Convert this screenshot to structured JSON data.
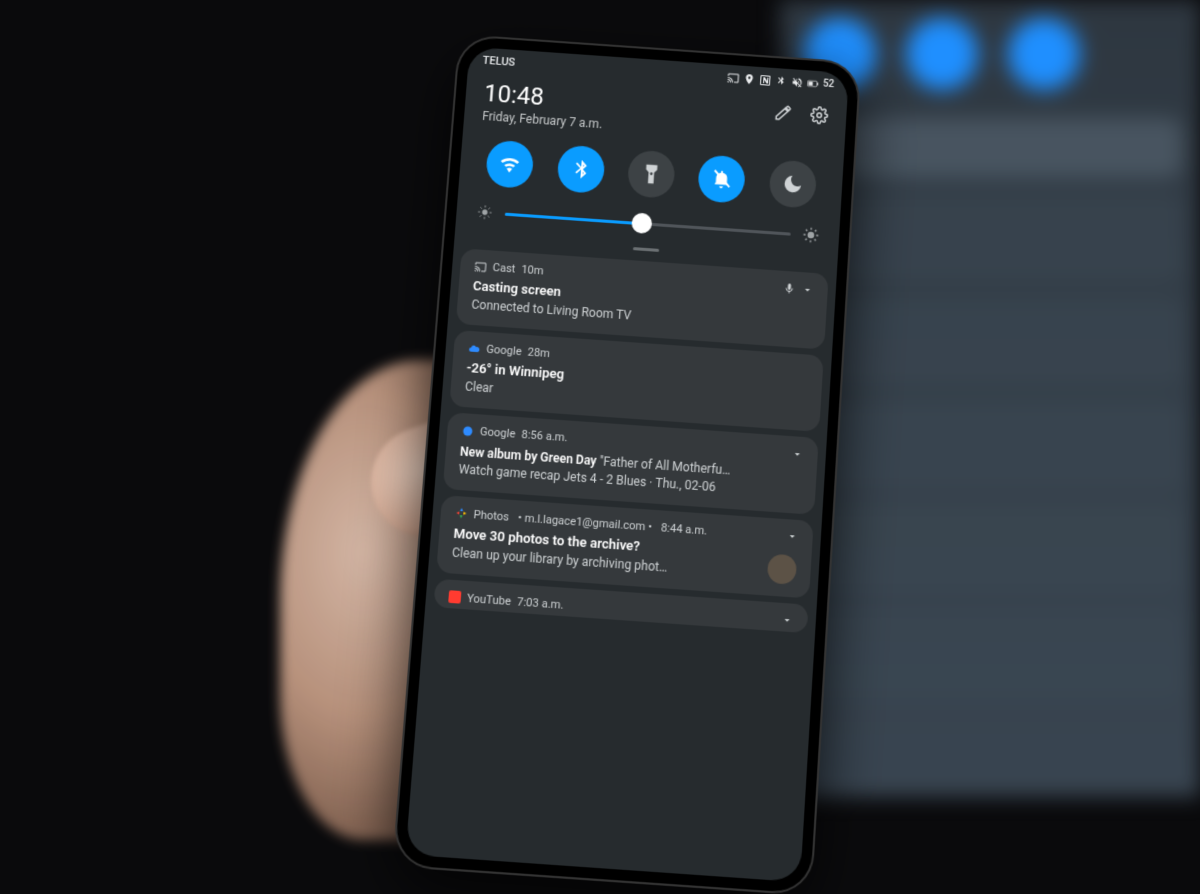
{
  "status": {
    "carrier": "TELUS",
    "battery_text": "52"
  },
  "header": {
    "time": "10:48",
    "date": "Friday, February 7  a.m."
  },
  "toggles": {
    "wifi": true,
    "bluetooth": true,
    "flashlight": false,
    "dnd_bell": true,
    "night": false
  },
  "brightness": {
    "percent": 48
  },
  "notifications": [
    {
      "app": "Cast",
      "time": "10m",
      "title": "Casting screen",
      "body": "Connected to Living Room TV",
      "icon_color": "#9fa4a6",
      "extras": "mic"
    },
    {
      "app": "Google",
      "time": "28m",
      "title": "-26° in Winnipeg",
      "body": "Clear",
      "icon_color": "#2e8bff"
    },
    {
      "app": "Google",
      "time": "8:56 a.m.",
      "title_inline": "New album by Green Day",
      "title_rest": " \"Father of All Motherfu…",
      "body": "Watch game recap Jets 4 - 2 Blues · Thu., 02-06",
      "icon_color": "#2e8bff"
    },
    {
      "app": "Photos",
      "account": "m.l.lagace1@gmail.com",
      "time": "8:44 a.m.",
      "title": "Move 30 photos to the archive?",
      "body": "Clean up your library by archiving phot…",
      "icon_color": "#2e8bff",
      "avatar": true
    },
    {
      "app": "YouTube",
      "time": "7:03 a.m.",
      "icon_color": "#ff3b30"
    }
  ]
}
